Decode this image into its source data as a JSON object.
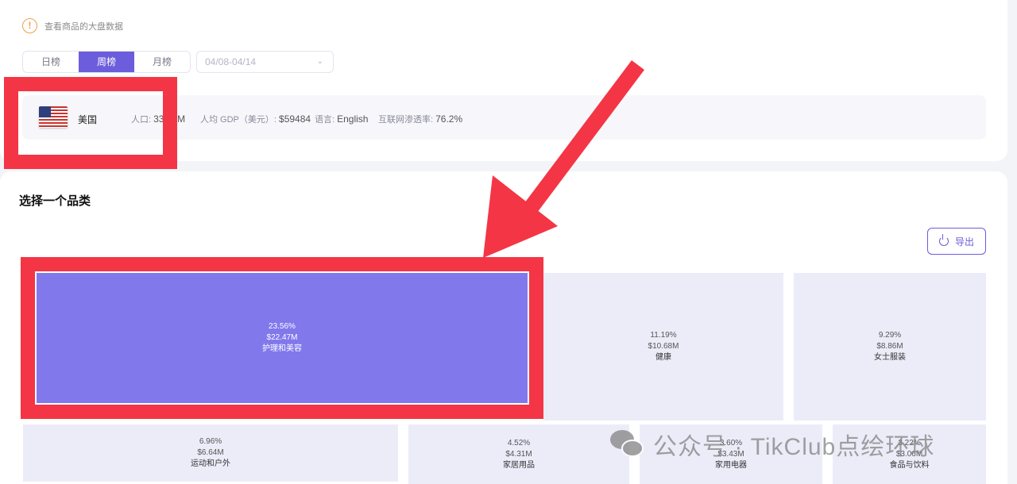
{
  "header": {
    "hint_icon": "!",
    "hint_text": "查看商品的大盘数据"
  },
  "tabs": [
    {
      "label": "日榜",
      "active": false
    },
    {
      "label": "周榜",
      "active": true
    },
    {
      "label": "月榜",
      "active": false
    }
  ],
  "date_select": {
    "value": "04/08-04/14",
    "icon": "chevron-down-icon"
  },
  "country": {
    "name": "美国",
    "population_label": "人口: ",
    "population_value": "33",
    "population_suffix": "0M",
    "gdp_label": "人均 GDP（美元）: ",
    "gdp_value": "$59484",
    "language_label": "语言: ",
    "language_value": "English",
    "internet_label": "互联网渗透率: ",
    "internet_value": "76.2%"
  },
  "section": {
    "title": "选择一个品类",
    "export_label": "导出"
  },
  "treemap": [
    {
      "pct": "23.56%",
      "value": "$22.47M",
      "name": "护理和美容",
      "highlighted": true
    },
    {
      "pct": "11.19%",
      "value": "$10.68M",
      "name": "健康"
    },
    {
      "pct": "9.29%",
      "value": "$8.86M",
      "name": "女士服装"
    },
    {
      "pct": "6.96%",
      "value": "$6.64M",
      "name": "运动和户外"
    },
    {
      "pct": "4.52%",
      "value": "$4.31M",
      "name": "家居用品"
    },
    {
      "pct": "3.60%",
      "value": "$3.43M",
      "name": "家用电器"
    },
    {
      "pct": "3.22%",
      "value": "$3.06M",
      "name": "食品与饮料"
    }
  ],
  "watermark": {
    "text": "公众号 · TikClub点绘环球"
  },
  "colors": {
    "accent": "#6c5ddc",
    "annotation_red": "#f43545",
    "tile_bg": "#ececf9",
    "tile_active": "#8178ec"
  }
}
